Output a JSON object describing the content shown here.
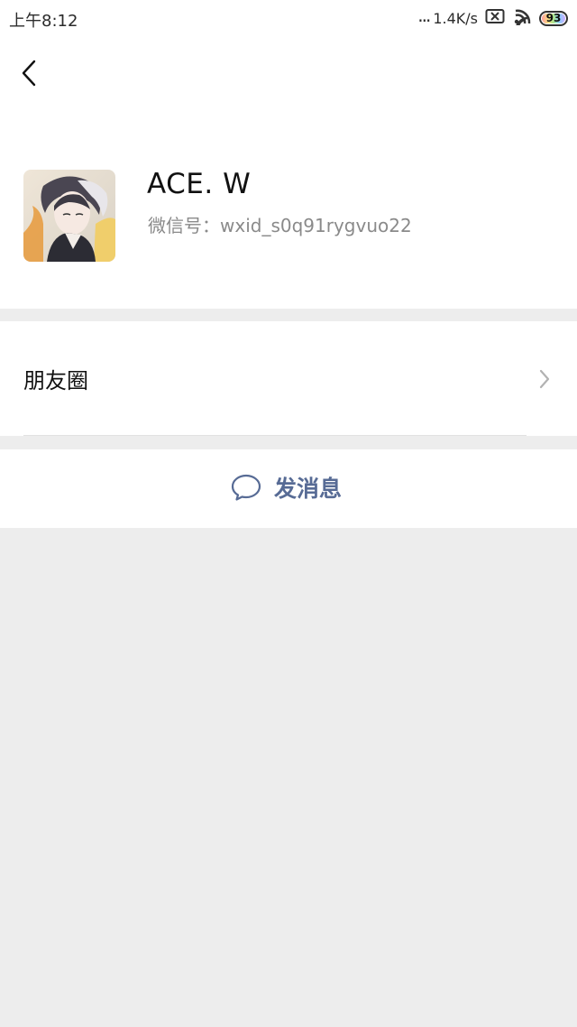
{
  "status_bar": {
    "time": "上午8:12",
    "signal_dots": "...",
    "net_speed": "1.4K/s",
    "battery": "93"
  },
  "profile": {
    "name": "ACE. W",
    "wechat_id": "微信号：wxid_s0q91rygvuo22"
  },
  "menu": {
    "moments_label": "朋友圈"
  },
  "actions": {
    "send_message_label": "发消息"
  },
  "colors": {
    "background": "#ededed",
    "card": "#ffffff",
    "link": "#576b95"
  },
  "icons": {
    "back": "back-arrow-icon",
    "chevron": "chevron-right-icon",
    "message": "chat-bubble-icon",
    "wifi": "wifi-icon",
    "sim": "no-sim-icon",
    "battery": "battery-icon"
  }
}
